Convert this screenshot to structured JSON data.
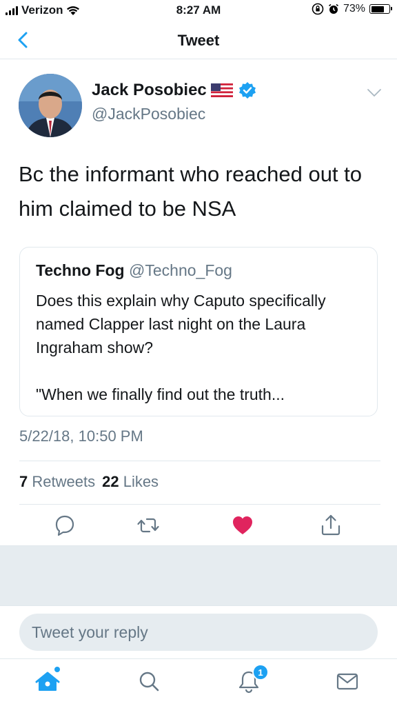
{
  "status_bar": {
    "carrier": "Verizon",
    "time": "8:27 AM",
    "battery": "73%",
    "battery_level": 0.73
  },
  "nav": {
    "title": "Tweet",
    "back_icon": "chevron-left-icon"
  },
  "tweet": {
    "author_name": "Jack Posobiec",
    "author_handle": "@JackPosobiec",
    "text": "Bc the informant who reached out to him claimed to be NSA",
    "timestamp": "5/22/18, 10:50 PM",
    "retweets_count": "7",
    "retweets_label": "Retweets",
    "likes_count": "22",
    "likes_label": "Likes",
    "liked": true
  },
  "quoted_tweet": {
    "name": "Techno Fog",
    "handle": "@Techno_Fog",
    "text": "Does this explain why Caputo specifically named Clapper last night on the Laura Ingraham show?\n\n\"When we finally find out the truth..."
  },
  "reply": {
    "placeholder": "Tweet your reply"
  },
  "tabbar": {
    "notifications_badge": "1"
  },
  "colors": {
    "accent": "#1da1f2",
    "like": "#e0245e",
    "secondary_text": "#657786",
    "border": "#e1e8ed"
  }
}
